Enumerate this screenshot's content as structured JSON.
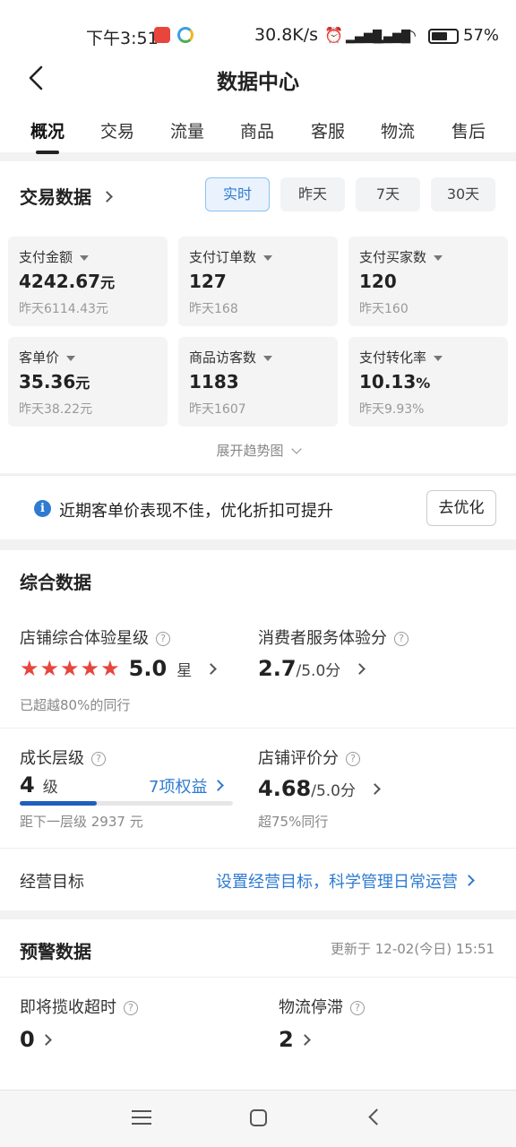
{
  "status_bar": {
    "time": "下午3:51",
    "net_speed": "30.8K/s",
    "battery": "57%",
    "icons": [
      "alarm-icon",
      "signal-hd-icon",
      "signal-hd-icon",
      "wifi-icon",
      "battery-icon"
    ]
  },
  "header": {
    "title": "数据中心",
    "tabs": [
      "概况",
      "交易",
      "流量",
      "商品",
      "客服",
      "物流",
      "售后"
    ],
    "active_tab": "概况"
  },
  "trade": {
    "title": "交易数据",
    "ranges": [
      "实时",
      "昨天",
      "7天",
      "30天"
    ],
    "active_range": "实时",
    "cards": [
      {
        "label": "支付金额",
        "value": "4242.67",
        "unit": "元",
        "prev": "昨天6114.43元"
      },
      {
        "label": "支付订单数",
        "value": "127",
        "unit": "",
        "prev": "昨天168"
      },
      {
        "label": "支付买家数",
        "value": "120",
        "unit": "",
        "prev": "昨天160"
      },
      {
        "label": "客单价",
        "value": "35.36",
        "unit": "元",
        "prev": "昨天38.22元"
      },
      {
        "label": "商品访客数",
        "value": "1183",
        "unit": "",
        "prev": "昨天1607"
      },
      {
        "label": "支付转化率",
        "value": "10.13",
        "unit": "%",
        "prev": "昨天9.93%"
      }
    ],
    "expand_label": "展开趋势图"
  },
  "tip": {
    "message": "近期客单价表现不佳，优化折扣可提升",
    "button": "去优化"
  },
  "comprehensive": {
    "title": "综合数据",
    "store_rating": {
      "label": "店铺综合体验星级",
      "stars": 5,
      "score": "5.0",
      "unit": "星",
      "sub": "已超越80%的同行"
    },
    "consumer_score": {
      "label": "消费者服务体验分",
      "score": "2.7",
      "unit": "/5.0分"
    },
    "growth": {
      "label": "成长层级",
      "level": "4",
      "level_unit": "级",
      "benefits": "7项权益",
      "progress": 0.36,
      "sub": "距下一层级 2937 元"
    },
    "review_score": {
      "label": "店铺评价分",
      "score": "4.68",
      "unit": "/5.0分",
      "sub": "超75%同行"
    },
    "goal": {
      "label": "经营目标",
      "link": "设置经营目标，科学管理日常运营"
    }
  },
  "warning": {
    "title": "预警数据",
    "updated": "更新于 12-02(今日) 15:51",
    "items": [
      {
        "label": "即将揽收超时",
        "value": "0"
      },
      {
        "label": "物流停滞",
        "value": "2"
      }
    ]
  },
  "colors": {
    "accent": "#2f7bd0",
    "star": "#e8453c",
    "progress": "#1f5fbf"
  }
}
